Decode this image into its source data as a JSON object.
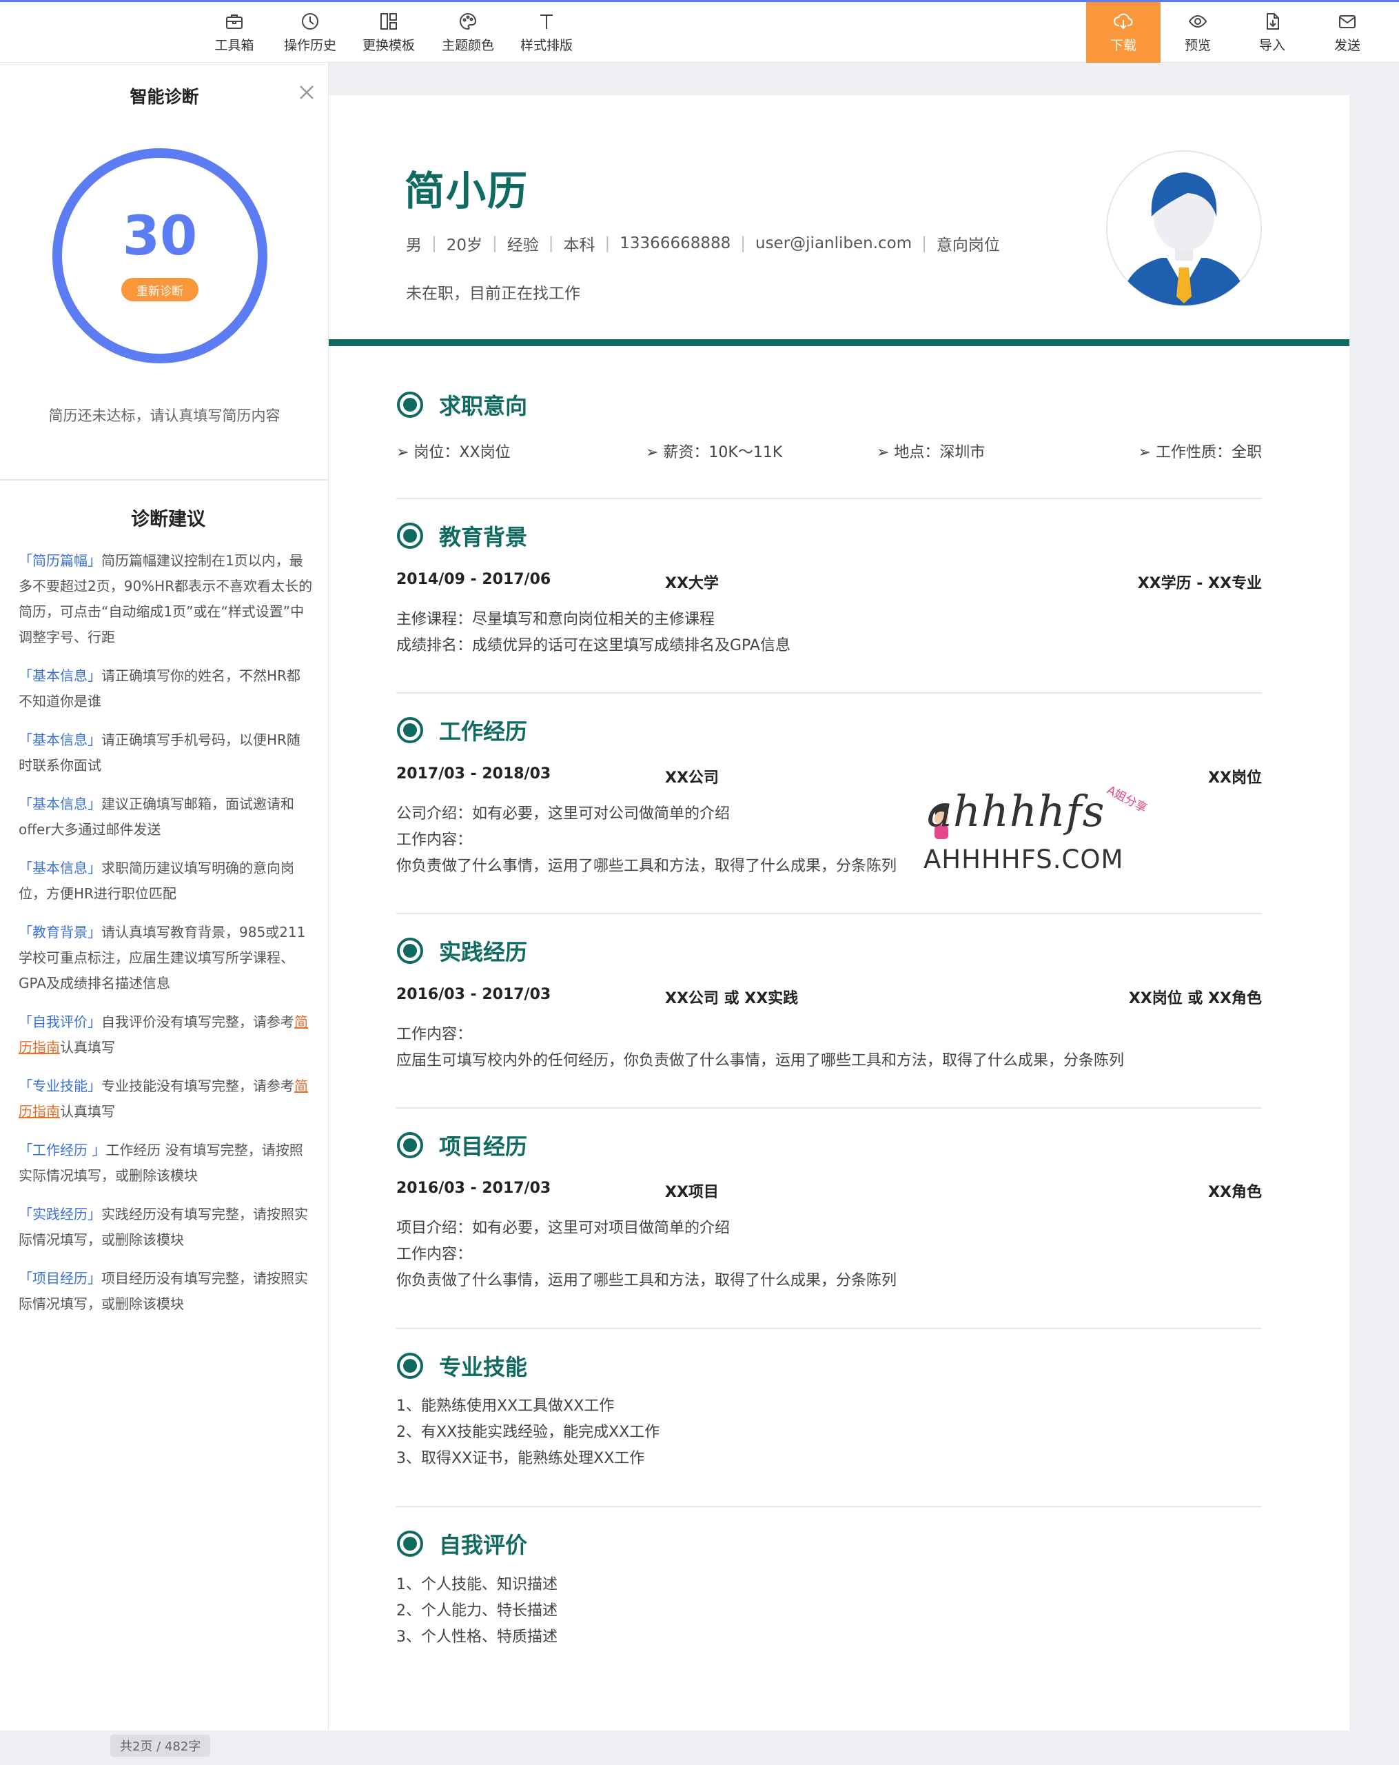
{
  "toolbar": {
    "left": [
      {
        "id": "toolbox",
        "label": "工具箱",
        "icon": "toolbox-icon"
      },
      {
        "id": "history",
        "label": "操作历史",
        "icon": "clock-icon"
      },
      {
        "id": "template",
        "label": "更换模板",
        "icon": "layout-icon"
      },
      {
        "id": "color",
        "label": "主题颜色",
        "icon": "palette-icon"
      },
      {
        "id": "style",
        "label": "样式排版",
        "icon": "text-icon"
      }
    ],
    "right": [
      {
        "id": "download",
        "label": "下载",
        "icon": "cloud-download-icon",
        "active": true
      },
      {
        "id": "preview",
        "label": "预览",
        "icon": "eye-icon"
      },
      {
        "id": "import",
        "label": "导入",
        "icon": "import-icon"
      },
      {
        "id": "send",
        "label": "发送",
        "icon": "mail-icon"
      }
    ]
  },
  "sidebar": {
    "title": "智能诊断",
    "score": "30",
    "score_fraction": 0.3,
    "rediagnose_label": "重新诊断",
    "score_message": "简历还未达标，请认真填写简历内容",
    "suggestions_title": "诊断建议",
    "suggestions": [
      {
        "tag": "「简历篇幅」",
        "text": "简历篇幅建议控制在1页以内，最多不要超过2页，90%HR都表示不喜欢看太长的简历，可点击“自动缩成1页”或在“样式设置”中调整字号、行距"
      },
      {
        "tag": "「基本信息」",
        "text": "请正确填写你的姓名，不然HR都不知道你是谁"
      },
      {
        "tag": "「基本信息」",
        "text": "请正确填写手机号码，以便HR随时联系你面试"
      },
      {
        "tag": "「基本信息」",
        "text": "建议正确填写邮箱，面试邀请和offer大多通过邮件发送"
      },
      {
        "tag": "「基本信息」",
        "text": "求职简历建议填写明确的意向岗位，方便HR进行职位匹配"
      },
      {
        "tag": "「教育背景」",
        "text": "请认真填写教育背景，985或211学校可重点标注，应届生建议填写所学课程、GPA及成绩排名描述信息"
      },
      {
        "tag": "「自我评价」",
        "text": "自我评价没有填写完整，请参考",
        "link": "简历指南",
        "tail": "认真填写"
      },
      {
        "tag": "「专业技能」",
        "text": "专业技能没有填写完整，请参考",
        "link": "简历指南",
        "tail": "认真填写"
      },
      {
        "tag": "「工作经历 」",
        "text": "工作经历 没有填写完整，请按照实际情况填写，或删除该模块"
      },
      {
        "tag": "「实践经历」",
        "text": "实践经历没有填写完整，请按照实际情况填写，或删除该模块"
      },
      {
        "tag": "「项目经历」",
        "text": "项目经历没有填写完整，请按照实际情况填写，或删除该模块"
      }
    ],
    "page_count": "共2页 / 482字"
  },
  "resume": {
    "name": "简小历",
    "info": [
      "男",
      "20岁",
      "经验",
      "本科",
      "13366668888",
      "user@jianliben.com",
      "意向岗位"
    ],
    "status": "未在职，目前正在找工作",
    "intent": {
      "title": "求职意向",
      "items": [
        "➢ 岗位：XX岗位",
        "➢ 薪资：10K～11K",
        "➢ 地点：深圳市",
        "➢ 工作性质：全职"
      ]
    },
    "education": {
      "title": "教育背景",
      "date": "2014/09 - 2017/06",
      "school": "XX大学",
      "degree": "XX学历 - XX专业",
      "lines": [
        "主修课程：尽量填写和意向岗位相关的主修课程",
        "成绩排名：成绩优异的话可在这里填写成绩排名及GPA信息"
      ]
    },
    "work": {
      "title": "工作经历",
      "date": "2017/03 - 2018/03",
      "org": "XX公司",
      "role": "XX岗位",
      "lines": [
        "公司介绍：如有必要，这里可对公司做简单的介绍",
        "工作内容：",
        "你负责做了什么事情，运用了哪些工具和方法，取得了什么成果，分条陈列"
      ]
    },
    "practice": {
      "title": "实践经历",
      "date": "2016/03 - 2017/03",
      "org": "XX公司 或 XX实践",
      "role": "XX岗位 或 XX角色",
      "lines": [
        "工作内容：",
        "应届生可填写校内外的任何经历，你负责做了什么事情，运用了哪些工具和方法，取得了什么成果，分条陈列"
      ]
    },
    "project": {
      "title": "项目经历",
      "date": "2016/03 - 2017/03",
      "org": "XX项目",
      "role": "XX角色",
      "lines": [
        "项目介绍：如有必要，这里可对项目做简单的介绍",
        "工作内容：",
        "你负责做了什么事情，运用了哪些工具和方法，取得了什么成果，分条陈列"
      ]
    },
    "skills": {
      "title": "专业技能",
      "lines": [
        "1、能熟练使用XX工具做XX工作",
        "2、有XX技能实践经验，能完成XX工作",
        "3、取得XX证书，能熟练处理XX工作"
      ]
    },
    "self_eval": {
      "title": "自我评价",
      "lines": [
        "1、个人技能、知识描述",
        "2、个人能力、特长描述",
        "3、个人性格、特质描述"
      ]
    }
  },
  "watermark": {
    "logo_text": "ahhhhfs",
    "sub_text": "A姐分享",
    "site": "AHHHHFS.COM"
  },
  "colors": {
    "accent_blue": "#5b7cf3",
    "accent_orange": "#f9973a",
    "theme_green": "#0f6b62",
    "link_blue": "#3a6fd8"
  }
}
